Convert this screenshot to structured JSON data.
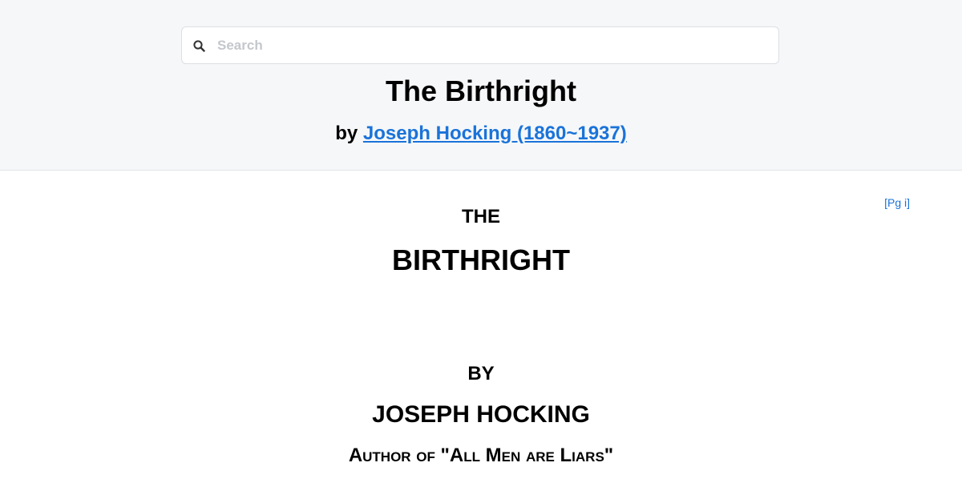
{
  "search": {
    "placeholder": "Search",
    "icon": "search-icon"
  },
  "book": {
    "title": "The Birthright",
    "by_prefix": "by",
    "author_link": "Joseph Hocking (1860~1937)"
  },
  "content": {
    "page_marker": "[Pg i]",
    "line_the": "THE",
    "line_birthright": "BIRTHRIGHT",
    "line_by": "BY",
    "line_author": "JOSEPH HOCKING",
    "line_author_of": "Author of \"All Men are Liars\""
  },
  "colors": {
    "link": "#1a73d9",
    "header_bg": "#f6f7f9"
  }
}
